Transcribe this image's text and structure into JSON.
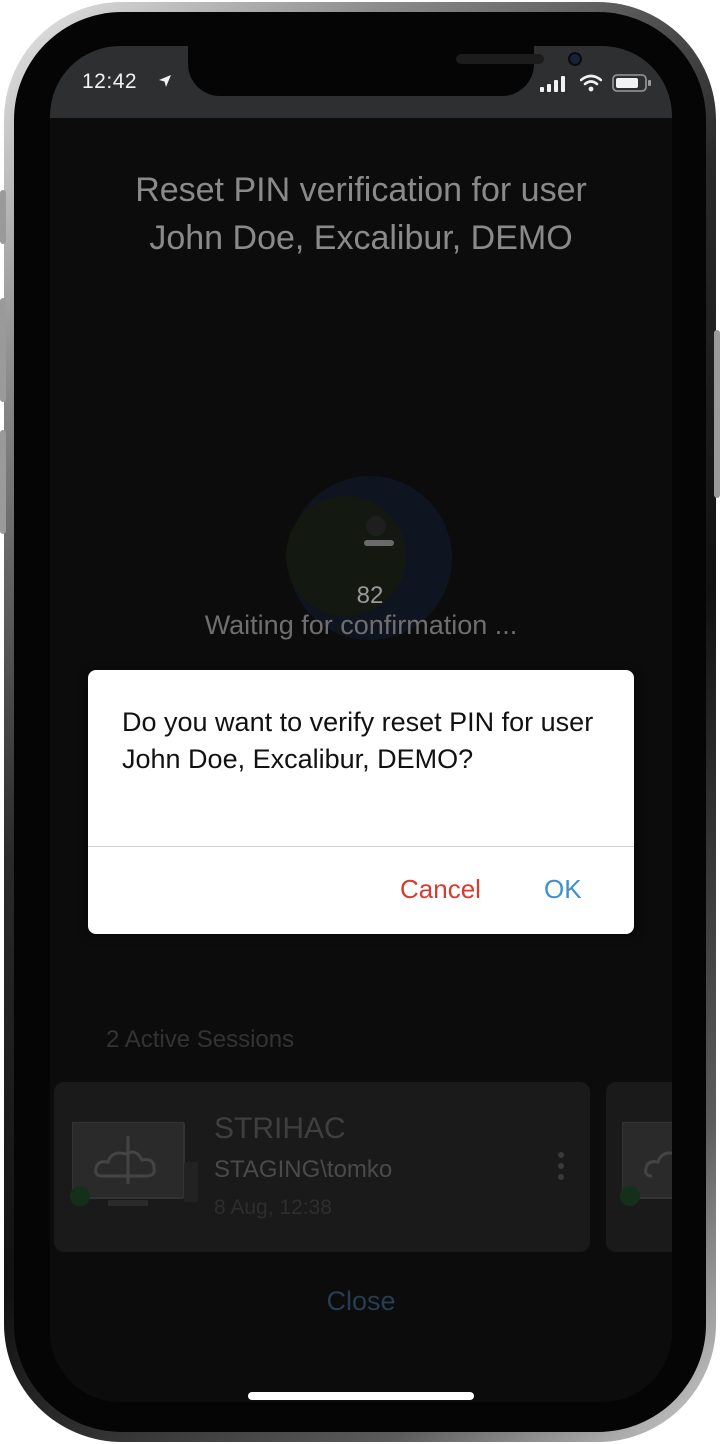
{
  "status_bar": {
    "time": "12:42"
  },
  "screen": {
    "title_line1": "Reset PIN verification for user",
    "title_line2": "John Doe, Excalibur, DEMO",
    "countdown": "82",
    "waiting_text": "Waiting for confirmation ..."
  },
  "sessions": {
    "label": "2 Active Sessions",
    "items": [
      {
        "name": "STRIHAC",
        "user": "STAGING\\tomko",
        "date": "8 Aug, 12:38"
      }
    ]
  },
  "close_label": "Close",
  "dialog": {
    "message": "Do you want to verify reset PIN for user John Doe, Excalibur, DEMO?",
    "cancel_label": "Cancel",
    "ok_label": "OK"
  },
  "colors": {
    "cancel": "#d93a2e",
    "ok": "#3d8fd6"
  },
  "icons": {
    "status": [
      "location-arrow-icon",
      "cellular-signal-icon",
      "wifi-icon",
      "battery-icon"
    ],
    "session": [
      "monitor-icon",
      "cloud-icon",
      "kebab-menu-icon"
    ]
  }
}
